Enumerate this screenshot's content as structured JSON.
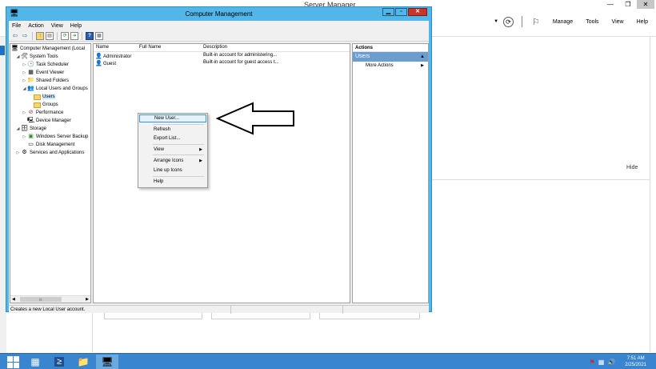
{
  "server_manager": {
    "title": "Server Manager",
    "nav": {
      "manage": "Manage",
      "tools": "Tools",
      "view": "View",
      "help": "Help"
    },
    "hide_label": "Hide",
    "window_buttons": {
      "minimize": "—",
      "maximize": "❐",
      "close": "✕"
    }
  },
  "computer_management": {
    "title": "Computer Management",
    "window_buttons": {
      "minimize": "▁",
      "maximize": "▫",
      "close": "✕"
    },
    "menu": [
      "File",
      "Action",
      "View",
      "Help"
    ],
    "tree": [
      {
        "label": "Computer Management (Local"
      },
      {
        "label": "System Tools"
      },
      {
        "label": "Task Scheduler"
      },
      {
        "label": "Event Viewer"
      },
      {
        "label": "Shared Folders"
      },
      {
        "label": "Local Users and Groups"
      },
      {
        "label": "Users"
      },
      {
        "label": "Groups"
      },
      {
        "label": "Performance"
      },
      {
        "label": "Device Manager"
      },
      {
        "label": "Storage"
      },
      {
        "label": "Windows Server Backup"
      },
      {
        "label": "Disk Management"
      },
      {
        "label": "Services and Applications"
      }
    ],
    "list": {
      "columns": [
        "Name",
        "Full Name",
        "Description"
      ],
      "rows": [
        {
          "name": "Administrator",
          "full_name": "",
          "description": "Built-in account for administering..."
        },
        {
          "name": "Guest",
          "full_name": "",
          "description": "Built-in account for guest access t..."
        }
      ]
    },
    "actions": {
      "header": "Actions",
      "section": "Users",
      "more_actions": "More Actions"
    },
    "status_text": "Creates a new Local User account."
  },
  "context_menu": {
    "items": [
      {
        "label": "New User..."
      },
      {
        "label": "Refresh"
      },
      {
        "label": "Export List..."
      },
      {
        "label": "View"
      },
      {
        "label": "Arrange Icons"
      },
      {
        "label": "Line up Icons"
      },
      {
        "label": "Help"
      }
    ]
  },
  "taskbar": {
    "time": "7:51 AM",
    "date": "2/25/2021"
  },
  "colors": {
    "window_frame": "#52b6e8",
    "taskbar": "#3a85cf",
    "actions_section": "#6b9dd1",
    "context_highlight": "#e5f1fb"
  }
}
